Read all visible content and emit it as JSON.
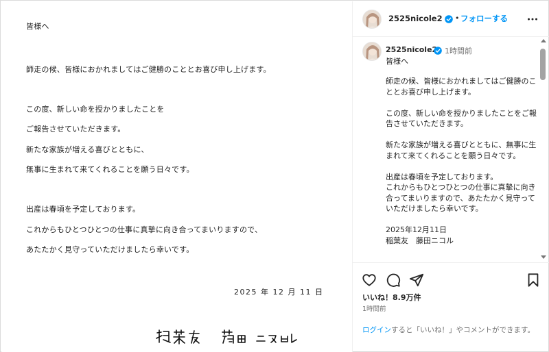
{
  "letter": {
    "lines": [
      "皆様へ",
      "師走の候、皆様におかれましてはご健勝のこととお喜び申し上げます。",
      "この度、新しい命を授かりましたことを",
      "ご報告させていただきます。",
      "新たな家族が増える喜びとともに、",
      "無事に生まれて来てくれることを願う日々です。",
      "出産は春頃を予定しております。",
      "これからもひとつひとつの仕事に真摯に向き合ってまいりますので、",
      "あたたかく見守っていただけましたら幸いです。"
    ],
    "date": "2025 年 12 月 11 日",
    "signature": "稲葉友　藤田ニコル"
  },
  "header": {
    "username": "2525nicole2",
    "separator": "•",
    "follow_label": "フォローする"
  },
  "caption": {
    "username": "2525nicole2",
    "time_ago": "1時間前",
    "greeting": "皆様へ",
    "body": "師走の候、皆様におかれましてはご健勝のこととお喜び申し上げます。\n\nこの度、新しい命を授かりましたことをご報告させていただきます。\n\n新たな家族が増える喜びとともに、無事に生まれて来てくれることを願う日々です。\n\n出産は春頃を予定しております。\nこれからもひとつひとつの仕事に真摯に向き合ってまいりますので、あたたかく見守っていただけましたら幸いです。\n\n2025年12月11日\n稲葉友　藤田ニコル"
  },
  "actions": {
    "likes": "いいね！8.9万件",
    "time": "1時間前",
    "login_link": "ログイン",
    "login_rest": "すると「いいね！」やコメントができます。"
  },
  "icons": {
    "heart": "heart-icon",
    "comment": "comment-icon",
    "share": "share-icon",
    "bookmark": "bookmark-icon",
    "more": "more-icon",
    "verified": "verified-icon"
  },
  "colors": {
    "accent": "#0095f6",
    "text": "#262626",
    "muted": "#737373",
    "border": "#dbdbdb"
  }
}
